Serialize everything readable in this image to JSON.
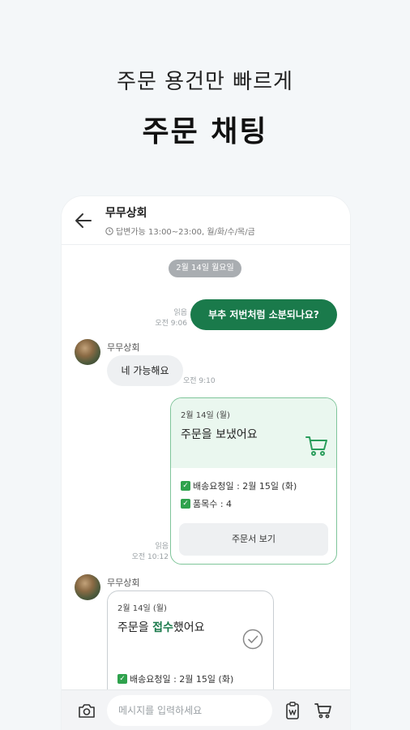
{
  "hero": {
    "subtitle": "주문 용건만 빠르게",
    "title": "주문 채팅"
  },
  "header": {
    "shop_name": "무무상회",
    "hours": "답변가능 13:00~23:00, 월/화/수/목/금"
  },
  "date_divider": "2월 14일 월요일",
  "messages": {
    "out1": {
      "text": "부추 저번처럼 소분되나요?",
      "read": "읽음",
      "time": "오전 9:06"
    },
    "in1": {
      "sender": "무무상회",
      "text": "네 가능해요",
      "time": "오전 9:10"
    },
    "order_sent": {
      "date": "2월 14일 (월)",
      "title": "주문을 보냈어요",
      "delivery_label": "배송요청일 : 2월 15일 (화)",
      "items_label": "품목수 : 4",
      "button": "주문서 보기",
      "read": "읽음",
      "time": "오전 10:12"
    },
    "order_received": {
      "sender": "무무상회",
      "date": "2월 14일 (월)",
      "title_pre": "주문을 ",
      "title_highlight": "접수",
      "title_post": "했어요",
      "delivery_label": "배송요청일 : 2월 15일 (화)"
    }
  },
  "input": {
    "placeholder": "메시지를 입력하세요"
  },
  "colors": {
    "accent": "#1a7a4b",
    "check": "#2fa24d",
    "card_border": "#7fc59a"
  },
  "icons": [
    "back-arrow-icon",
    "clock-icon",
    "cart-icon",
    "check-icon",
    "circle-check-icon",
    "camera-icon",
    "clipboard-icon"
  ]
}
